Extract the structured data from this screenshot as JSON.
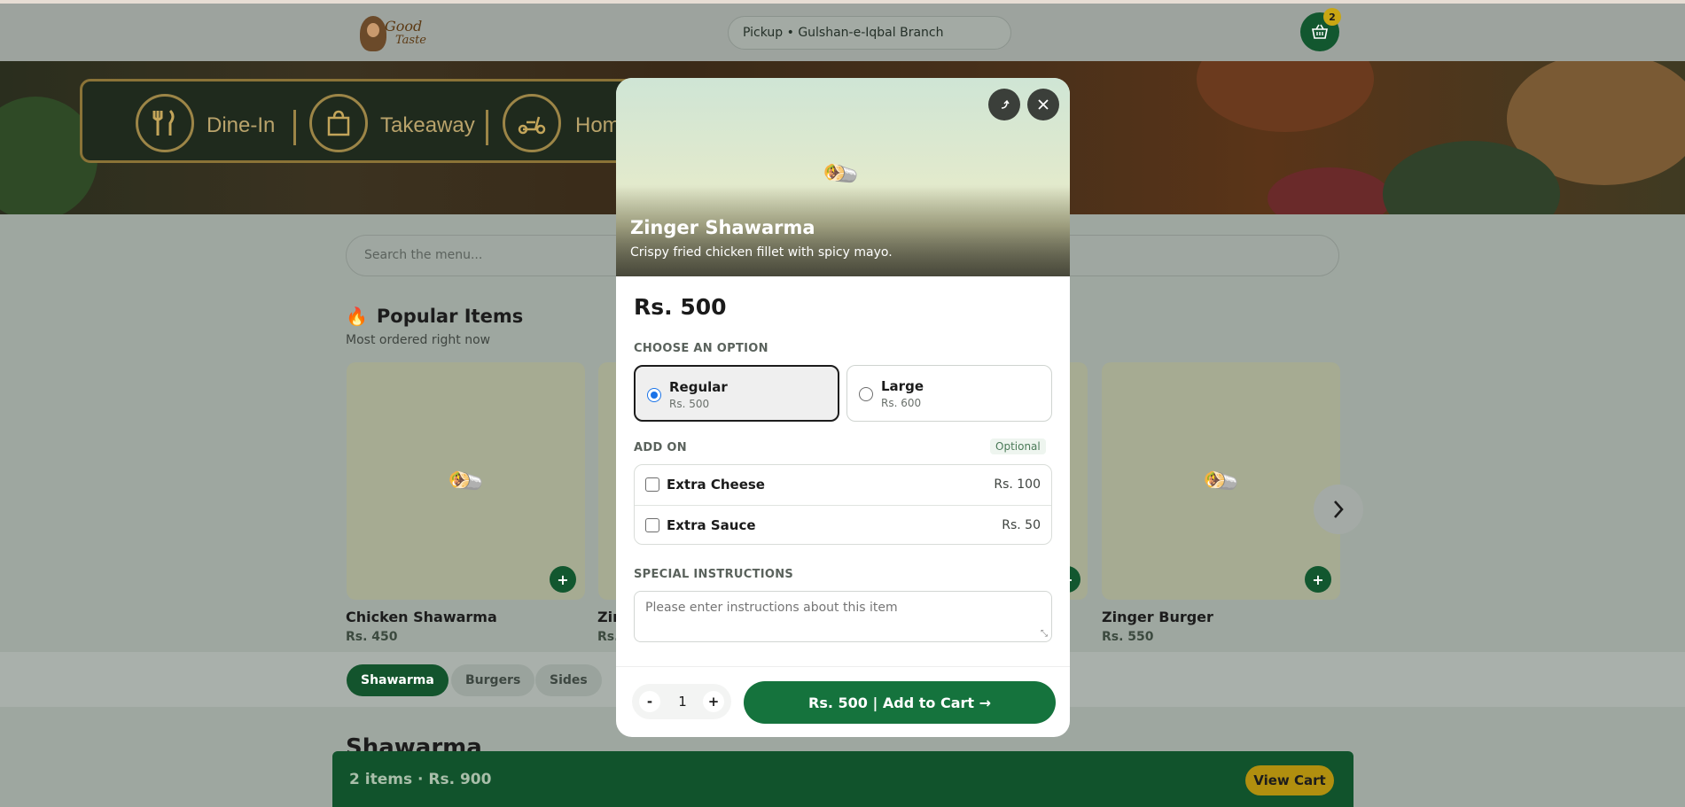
{
  "header": {
    "logo_line1": "Good",
    "logo_line2": "Taste",
    "branch": "Pickup • Gulshan-e-Iqbal Branch",
    "cart_count": "2"
  },
  "banner": {
    "services": [
      "Dine-In",
      "Takeaway",
      "Hom"
    ]
  },
  "search": {
    "placeholder": "Search the menu..."
  },
  "popular": {
    "title": "Popular Items",
    "subtitle": "Most ordered right now",
    "items": [
      {
        "name": "Chicken Shawarma",
        "price": "Rs. 450"
      },
      {
        "name": "Zir",
        "price": "Rs."
      },
      {
        "name": "Zinger Burger",
        "price": "Rs. 550"
      }
    ]
  },
  "categories": [
    "Shawarma",
    "Burgers",
    "Sides"
  ],
  "section_heading": "Shawarma",
  "cart_bar": {
    "summary": "2 items · Rs. 900",
    "button": "View Cart"
  },
  "modal": {
    "title": "Zinger Shawarma",
    "description": "Crispy fried chicken fillet with spicy mayo.",
    "price": "Rs. 500",
    "options_label": "CHOOSE AN OPTION",
    "options": [
      {
        "name": "Regular",
        "price": "Rs. 500",
        "selected": true
      },
      {
        "name": "Large",
        "price": "Rs. 600",
        "selected": false
      }
    ],
    "addon_label": "ADD ON",
    "addon_tag": "Optional",
    "addons": [
      {
        "name": "Extra Cheese",
        "price": "Rs. 100"
      },
      {
        "name": "Extra Sauce",
        "price": "Rs. 50"
      }
    ],
    "instructions_label": "SPECIAL INSTRUCTIONS",
    "instructions_placeholder": "Please enter instructions about this item",
    "quantity": "1",
    "minus": "-",
    "plus": "+",
    "add_button": "Rs. 500 | Add to Cart →"
  },
  "colors": {
    "brand_green": "#15733d",
    "dark_green": "#12572f",
    "badge_gold": "#c9a613"
  },
  "icons": [
    "cart-icon",
    "fork-knife-icon",
    "shopping-bag-icon",
    "scooter-icon",
    "fire-icon",
    "wrap-food-icon",
    "share-icon",
    "close-icon",
    "chevron-right-icon",
    "plus-icon"
  ]
}
